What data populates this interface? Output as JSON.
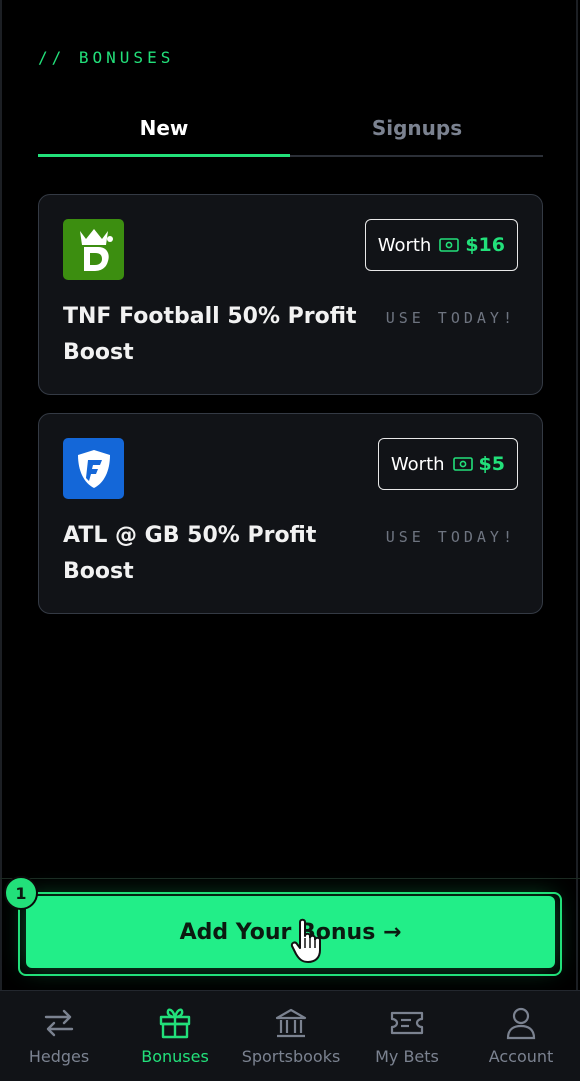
{
  "section_title": "// BONUSES",
  "tabs": [
    {
      "label": "New",
      "active": true
    },
    {
      "label": "Signups",
      "active": false
    }
  ],
  "bonuses": [
    {
      "title": "TNF Football 50% Profit Boost",
      "worth_label": "Worth",
      "amount": "$16",
      "note": "USE TODAY!",
      "book_icon": "draftkings-logo-icon"
    },
    {
      "title": "ATL @ GB 50% Profit Boost",
      "worth_label": "Worth",
      "amount": "$5",
      "note": "USE TODAY!",
      "book_icon": "fanduel-logo-icon"
    }
  ],
  "cta": {
    "label": "Add Your Bonus →",
    "step_badge": "1"
  },
  "nav": [
    {
      "label": "Hedges",
      "icon": "swap-arrows-icon",
      "active": false
    },
    {
      "label": "Bonuses",
      "icon": "gift-icon",
      "active": true
    },
    {
      "label": "Sportsbooks",
      "icon": "bank-icon",
      "active": false
    },
    {
      "label": "My Bets",
      "icon": "ticket-icon",
      "active": false
    },
    {
      "label": "Account",
      "icon": "user-icon",
      "active": false
    }
  ],
  "colors": {
    "accent": "#22e07a",
    "background": "#000000",
    "card": "#111317",
    "muted": "#7b8290"
  }
}
